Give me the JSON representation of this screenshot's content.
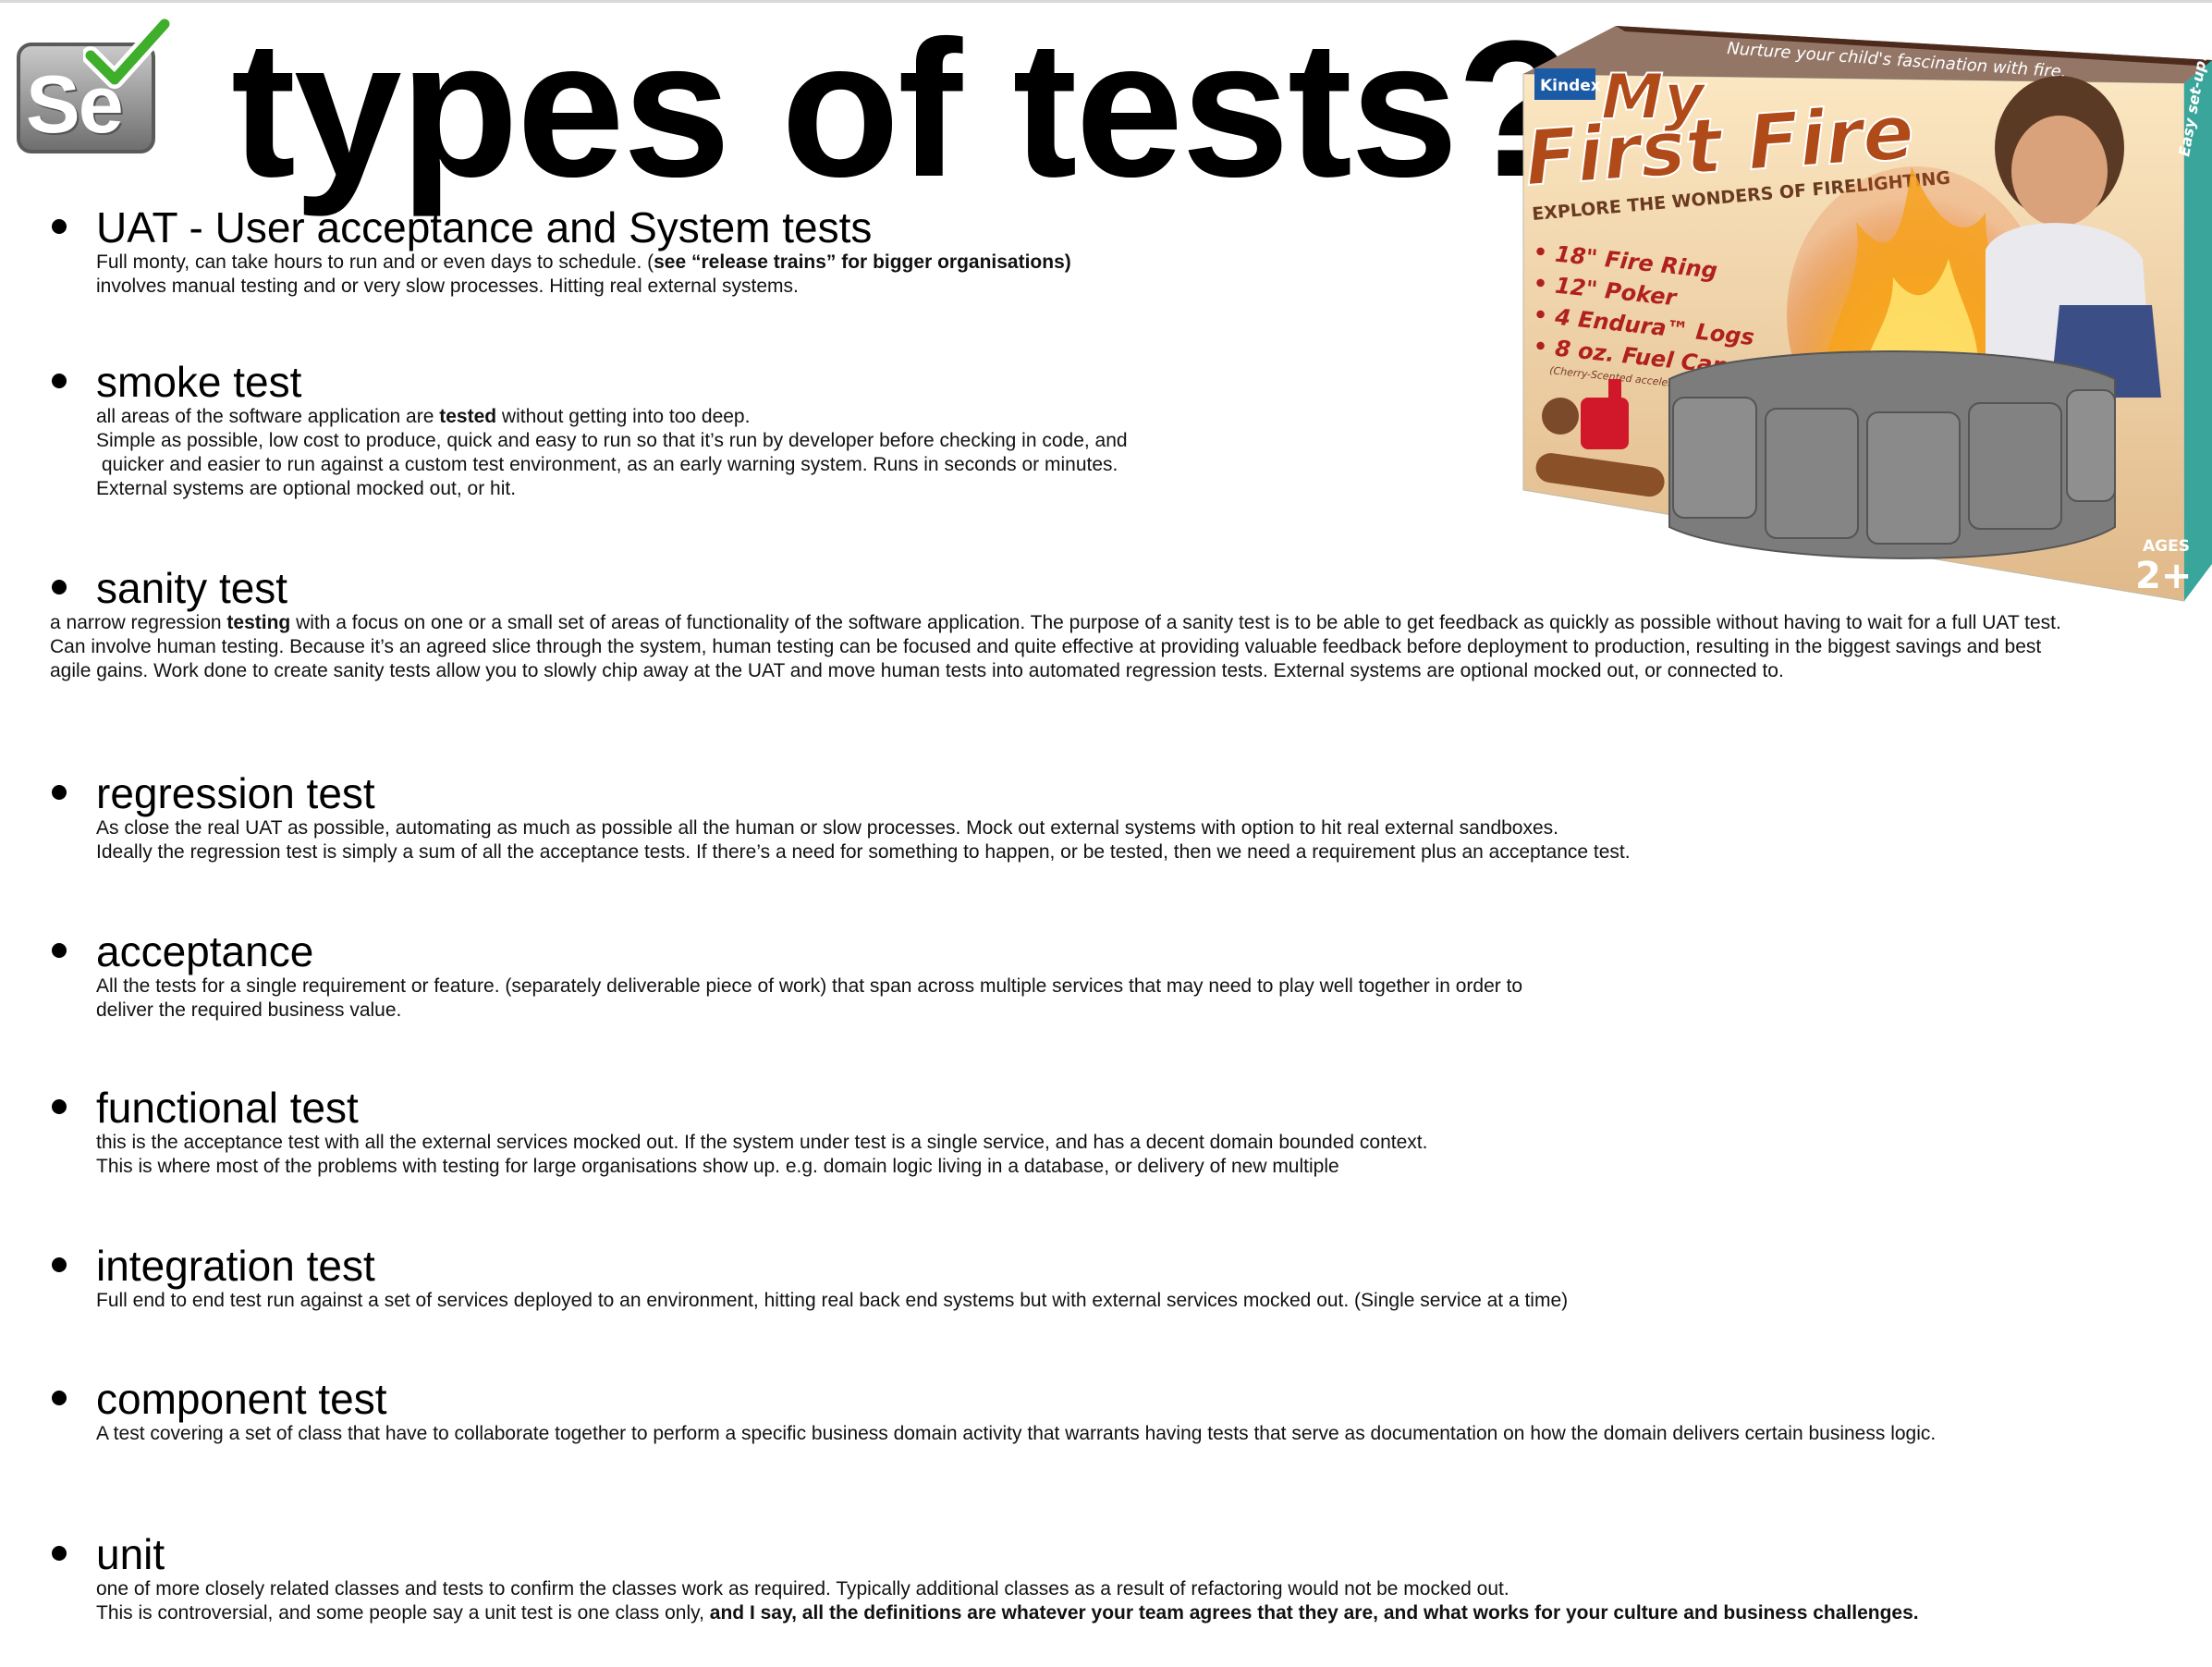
{
  "title": "types of tests?",
  "logo": {
    "text": "Se",
    "icon": "selenium-check-icon",
    "accent": "#3fae2a"
  },
  "product_box": {
    "brand": "Kindex",
    "name_line1": "My",
    "name_line2": "First Fire",
    "tm": "TM",
    "tagline": "EXPLORE THE WONDERS OF FIRELIGHTING",
    "top_banner": "Nurture your child's fascination with fire.",
    "items": [
      "• 18\" Fire Ring",
      "• 12\" Poker",
      "• 4 Endura™ Logs",
      "• 8 oz. Fuel Can"
    ],
    "fine_print": "(Cherry-Scented accelerant included)",
    "side_text": "Easy set-up!",
    "ages_label": "AGES",
    "ages_value": "2+"
  },
  "sections": {
    "uat": {
      "heading": "UAT - User acceptance and System tests",
      "line1_pre": "Full monty, can take hours to run and or even days to schedule. (",
      "line1_bold": "see “release trains” for bigger organisations)",
      "line2": "involves manual testing and or very slow processes. Hitting real external systems."
    },
    "smoke": {
      "heading": "smoke test",
      "line1_pre": "all areas of the software application are ",
      "line1_bold": "tested",
      "line1_post": " without getting into too deep.",
      "line2": "Simple as possible, low cost to produce, quick and easy to run so that it’s run by developer before checking in code, and",
      "line3": " quicker and easier to run against a custom test environment, as an early warning system. Runs in seconds or minutes.",
      "line4": "External systems are optional mocked out, or hit."
    },
    "sanity": {
      "heading": "sanity test",
      "text_pre": "a narrow regression ",
      "text_bold": "testing",
      "text_post": " with a focus on one or a small set of areas of functionality of the software application. The purpose of a sanity test is to be able to get feedback as quickly as possible without having to wait for a full UAT test. Can involve human testing. Because it’s an agreed slice through the system, human testing can be focused and quite effective at providing valuable feedback before deployment to production, resulting in the biggest savings and best agile gains. Work done to create sanity tests allow you to slowly chip away at the UAT and move human tests into automated regression tests. External systems are optional mocked out, or connected to."
    },
    "regression": {
      "heading": "regression test",
      "line1": "As close the real UAT as possible, automating as much as possible all the human or slow processes. Mock out external systems with option to hit real external sandboxes.",
      "line2": "Ideally the regression test is simply a sum of all the acceptance tests. If there’s a need for something to happen, or be tested, then we need a requirement plus an acceptance test."
    },
    "acceptance": {
      "heading": "acceptance",
      "line1": "All the tests for a single requirement or feature. (separately deliverable piece of work) that span across multiple services that may need to play well together in order to",
      "line2": "deliver the required business value."
    },
    "functional": {
      "heading": "functional test",
      "line1": "this is the acceptance test with all the external services mocked out. If the system under test is a single service, and has a decent domain bounded context.",
      "line2": "This is where most of the problems with testing for large organisations show up. e.g. domain logic living in a database, or delivery of new multiple"
    },
    "integration": {
      "heading": "integration test",
      "line1": "Full end to end test run against a set of services deployed to an environment, hitting real back end systems but with external services mocked out. (Single service at a time)"
    },
    "component": {
      "heading": "component test",
      "text": "A test covering a set of class that have to collaborate together to perform a specific business domain activity that warrants having tests that serve as documentation on how the domain delivers certain business logic."
    },
    "unit": {
      "heading": "unit",
      "line1": "one of more closely related classes and tests to confirm the classes work as required. Typically additional classes as a result of refactoring would not be mocked out.",
      "line2_pre": "This is controversial, and some people say a unit test is one class only, ",
      "line2_bold": "and I say, all the definitions are whatever your team agrees that they are, and what works for your culture and business challenges."
    }
  }
}
